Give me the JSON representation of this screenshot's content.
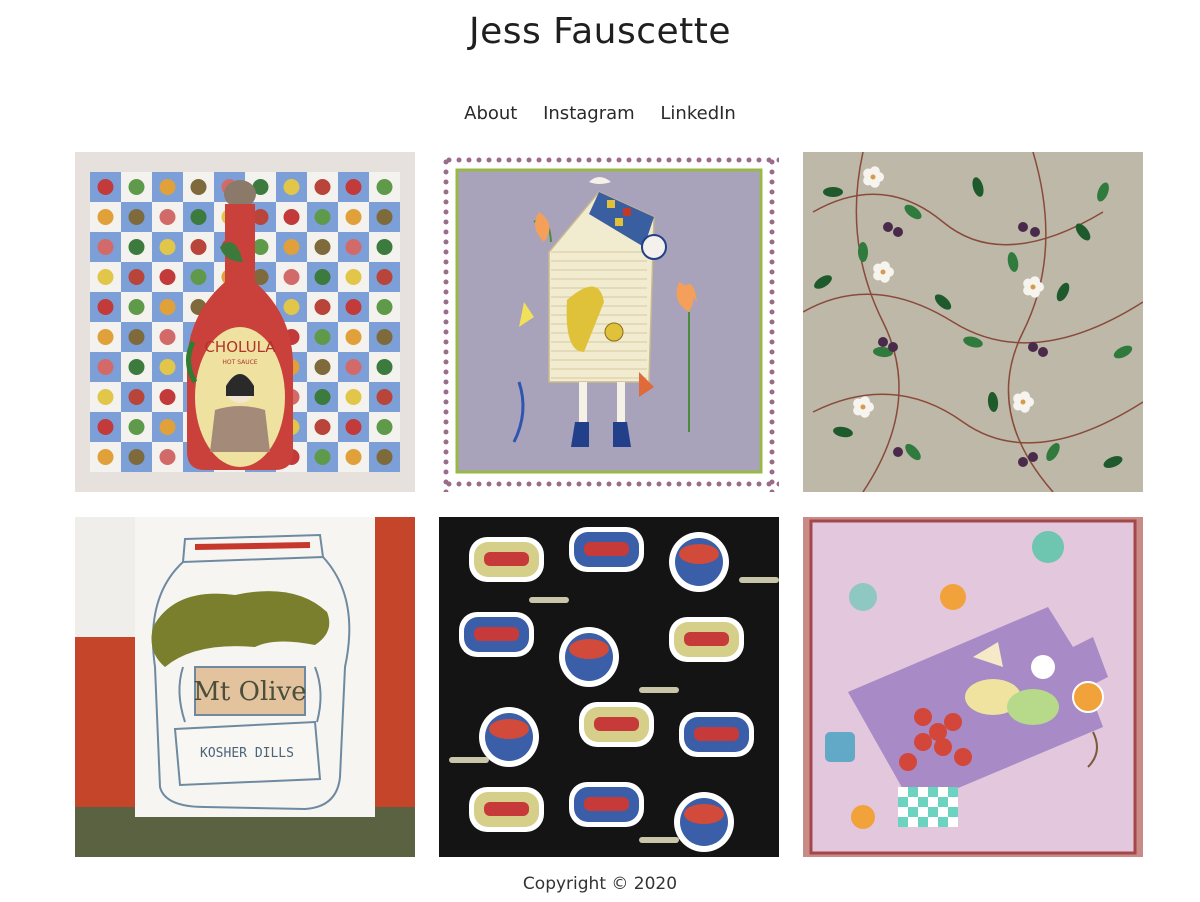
{
  "site": {
    "title": "Jess Fauscette"
  },
  "nav": {
    "items": [
      {
        "label": "About"
      },
      {
        "label": "Instagram"
      },
      {
        "label": "LinkedIn"
      }
    ]
  },
  "gallery": {
    "tiles": [
      {
        "artwork": "cholula-hot-sauce-embroidery",
        "label_text": "CHOLULA",
        "sub_text": "HOT SAUCE"
      },
      {
        "artwork": "birdhouse-scarf-illustration"
      },
      {
        "artwork": "blackberry-blossom-pattern"
      },
      {
        "artwork": "mt-olive-pickle-jar-embroidery",
        "label_text": "Mt Olive",
        "sub_text": "KOSHER DILLS"
      },
      {
        "artwork": "sardine-tins-pattern"
      },
      {
        "artwork": "picnic-board-scarf"
      }
    ]
  },
  "footer": {
    "copyright": "Copyright © 2020"
  },
  "colors": {
    "background": "#ffffff",
    "text": "#222222"
  }
}
